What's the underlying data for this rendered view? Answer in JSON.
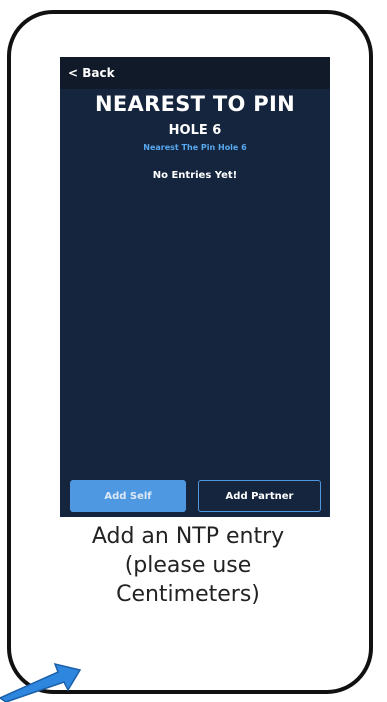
{
  "app": {
    "back_label": "< Back",
    "title": "NEAREST TO PIN",
    "hole": "HOLE 6",
    "subtitle": "Nearest The Pin Hole 6",
    "empty_message": "No Entries Yet!",
    "add_self_label": "Add Self",
    "add_partner_label": "Add Partner"
  },
  "caption": {
    "line1": "Add an NTP entry",
    "line2": "(please use",
    "line3": "Centimeters)"
  },
  "colors": {
    "screen_bg": "#14253d",
    "topbar_bg": "#111a28",
    "accent": "#4d98e0",
    "subtitle": "#58a8f0",
    "arrow": "#2e86de"
  },
  "icons": {
    "arrow": "blue-arrow-icon"
  }
}
